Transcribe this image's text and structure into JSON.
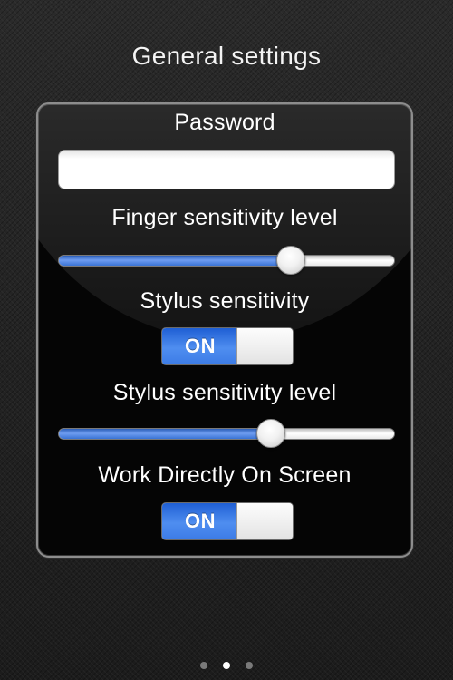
{
  "header": {
    "title": "General settings"
  },
  "panel": {
    "password": {
      "label": "Password",
      "value": "",
      "placeholder": ""
    },
    "finger_sensitivity": {
      "label": "Finger sensitivity level",
      "value_fraction": 0.69
    },
    "stylus_sensitivity": {
      "label": "Stylus sensitivity",
      "state_label": "ON"
    },
    "stylus_sensitivity_level": {
      "label": "Stylus sensitivity level",
      "value_fraction": 0.63
    },
    "work_directly": {
      "label": "Work Directly On Screen",
      "state_label": "ON"
    }
  },
  "pager": {
    "count": 3,
    "active_index": 1
  },
  "colors": {
    "accent_blue": "#3c7ce6",
    "panel_border": "#8d8d8d",
    "background": "#1f1f1f"
  }
}
